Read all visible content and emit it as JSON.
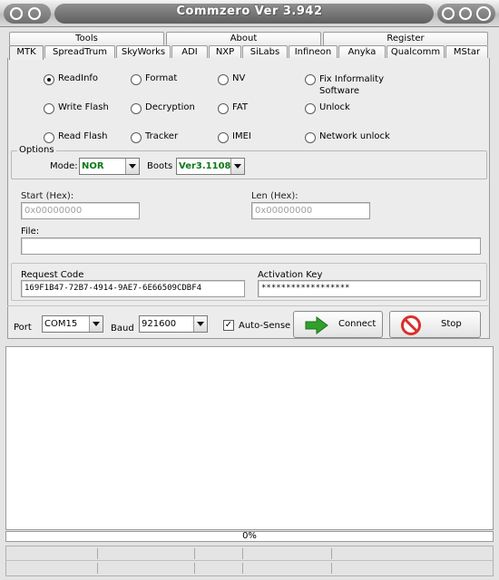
{
  "window": {
    "title": "Commzero Ver 3.942"
  },
  "tabs_top": [
    {
      "label": "Tools"
    },
    {
      "label": "About"
    },
    {
      "label": "Register"
    }
  ],
  "tabs": [
    {
      "label": "MTK",
      "active": true
    },
    {
      "label": "SpreadTrum"
    },
    {
      "label": "SkyWorks"
    },
    {
      "label": "ADI"
    },
    {
      "label": "NXP"
    },
    {
      "label": "SiLabs"
    },
    {
      "label": "Infineon"
    },
    {
      "label": "Anyka"
    },
    {
      "label": "Qualcomm"
    },
    {
      "label": "MStar"
    }
  ],
  "operations": [
    {
      "label": "ReadInfo",
      "selected": true
    },
    {
      "label": "Format"
    },
    {
      "label": "NV"
    },
    {
      "label": "Fix Informality\nSoftware"
    },
    {
      "label": "Write Flash"
    },
    {
      "label": "Decryption"
    },
    {
      "label": "FAT"
    },
    {
      "label": "Unlock"
    },
    {
      "label": "Read Flash"
    },
    {
      "label": "Tracker"
    },
    {
      "label": "IMEI"
    },
    {
      "label": "Network unlock"
    }
  ],
  "options": {
    "legend": "Options",
    "mode_label": "Mode:",
    "mode_value": "NOR",
    "boots_label": "Boots",
    "boots_value": "Ver3.1108"
  },
  "fields": {
    "start_label": "Start (Hex):",
    "start_value": "0x00000000",
    "len_label": "Len (Hex):",
    "len_value": "0x00000000",
    "file_label": "File:",
    "file_value": ""
  },
  "registration": {
    "request_label": "Request Code",
    "request_value": "169F1B47-72B7-4914-9AE7-6E66509CDBF4",
    "activation_label": "Activation Key",
    "activation_value": "******************"
  },
  "connection": {
    "port_label": "Port",
    "port_value": "COM15",
    "baud_label": "Baud",
    "baud_value": "921600",
    "autosense_label": "Auto-Sense",
    "autosense_checked": true,
    "connect_label": "Connect",
    "stop_label": "Stop"
  },
  "progress": {
    "value": 0,
    "text": "0%"
  },
  "colors": {
    "connect_arrow": "#2fa12b",
    "stop_icon": "#d9302a",
    "combo_text": "#0a7a16"
  },
  "icons": {
    "connect": "green-arrow-right-icon",
    "stop": "no-entry-icon"
  }
}
